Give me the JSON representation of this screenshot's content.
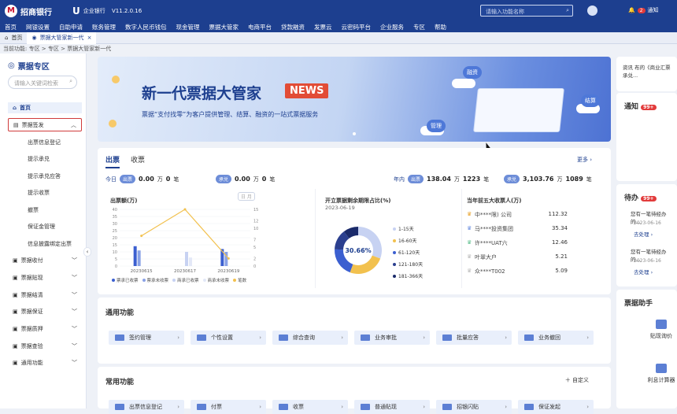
{
  "app": {
    "bank_name": "招商银行",
    "logo_subtitle": "CHINA MERCHANTS BANK",
    "enterprise_label": "企业银行",
    "version": "V11.2.0.16",
    "search_placeholder": "请输入功能名称",
    "notice_label": "通知",
    "notice_count": "2"
  },
  "menu": [
    "首页",
    "网银设置",
    "自助申请",
    "账务管理",
    "数字人民币钱包",
    "现金管理",
    "票据大管家",
    "电商平台",
    "贷款融资",
    "发票云",
    "云密码平台",
    "企业服务",
    "专区",
    "帮助"
  ],
  "tabs": [
    {
      "label": "首页"
    },
    {
      "label": "票据大管家新一代"
    }
  ],
  "breadcrumb": "当前功能: 专区 > 专区 > 票据大管家新一代",
  "sidebar": {
    "title": "票据专区",
    "search_placeholder": "请输入关键词检索",
    "home": "首页",
    "issue": "票据签发",
    "issue_sub": [
      "出票信息登记",
      "提示承兑",
      "提示承兑应答",
      "提示收票",
      "撤票",
      "保证金管理",
      "信息披露绑定出票"
    ],
    "groups": [
      "票据收付",
      "票据贴现",
      "票据结清",
      "票据保证",
      "票据质押",
      "票据查验",
      "通用功能"
    ]
  },
  "banner": {
    "title": "新一代票据大管家",
    "badge": "NEWS",
    "subtitle": "票据“支付找零”为客户提供管理、结算、融资的一站式票据服务",
    "tags": [
      "融资",
      "结算",
      "管理"
    ]
  },
  "stats": {
    "tabs": [
      "出票",
      "收票"
    ],
    "more": "更多",
    "today_label": "今日",
    "year_label": "年内",
    "pill_issue": "出票",
    "pill_accept": "承兑",
    "today_issue_amount": "0.00",
    "today_issue_count": "0",
    "today_accept_amount": "0.00",
    "today_accept_count": "0",
    "year_issue_amount": "138.04",
    "year_issue_count": "1223",
    "year_accept_amount": "3,103.76",
    "year_accept_count": "1089",
    "unit_wan": "万",
    "unit_bi": "笔",
    "chart_toggle": "日 月",
    "pie_title": "开立票据剩余期限占比(%)",
    "pie_date": "2023-06-19",
    "pie_center": "30.66%",
    "top5_title": "当年前五大收票人(万)",
    "top5": [
      {
        "name": "中****限) 公司",
        "value": "112.32"
      },
      {
        "name": "马****投资集团",
        "value": "35.34"
      },
      {
        "name": "许****UAT六",
        "value": "12.46"
      },
      {
        "name": "叶翠大户",
        "value": "5.21"
      },
      {
        "name": "众****T002",
        "value": "5.09"
      }
    ]
  },
  "chart_data": [
    {
      "type": "bar",
      "title": "出票额(万)",
      "categories": [
        "20230615",
        "20230617",
        "20230619"
      ],
      "series": [
        {
          "name": "票承已收票",
          "values": [
            14,
            0,
            12
          ]
        },
        {
          "name": "票承未收票",
          "values": [
            11,
            0,
            10
          ]
        },
        {
          "name": "商承已收票",
          "values": [
            0,
            10,
            0
          ]
        },
        {
          "name": "商承未收票",
          "values": [
            0,
            6,
            0
          ]
        },
        {
          "name": "笔数",
          "values": [
            8,
            15,
            2
          ]
        }
      ],
      "ylim": [
        0,
        40
      ],
      "y2lim": [
        0,
        15
      ],
      "yticks": [
        0,
        5,
        10,
        15,
        20,
        25,
        30,
        35,
        40
      ],
      "y2ticks": [
        0,
        2,
        5,
        7,
        10,
        12,
        15
      ]
    },
    {
      "type": "pie",
      "title": "开立票据剩余期限占比(%)",
      "categories": [
        "1-15天",
        "16-60天",
        "61-120天",
        "121-180天",
        "181-366天"
      ],
      "values": [
        30.66,
        25,
        20,
        14,
        10.34
      ],
      "center_label": "30.66%"
    }
  ],
  "functions": {
    "general_title": "通用功能",
    "general": [
      "签约管理",
      "个性设置",
      "综合查询",
      "业务审批",
      "批量应答",
      "业务撤回"
    ],
    "common_title": "常用功能",
    "common_custom": "自定义",
    "common": [
      "出票信息登记",
      "付票",
      "收票",
      "普通贴现",
      "招银闪贴",
      "保证发起"
    ]
  },
  "right": {
    "top_text": "资讯 布的《商业汇票承兑...",
    "notice_title": "通知",
    "notice_count": "99+",
    "todo_title": "待办",
    "todo_count": "99+",
    "todos": [
      {
        "text": "您有一笔待经办的...",
        "date": "2023-06-16",
        "link": "去处理"
      },
      {
        "text": "您有一笔待经办的...",
        "date": "2023-06-16",
        "link": "去处理"
      }
    ],
    "helper_title": "票据助手",
    "helpers": [
      "贴现询价",
      "利息计算器"
    ]
  },
  "colors": {
    "brand": "#1d3f8f",
    "accent": "#e24c36",
    "chart_blue": "#3b5fd0",
    "chart_light": "#bfcaf0",
    "chart_yellow": "#f2c14e"
  }
}
